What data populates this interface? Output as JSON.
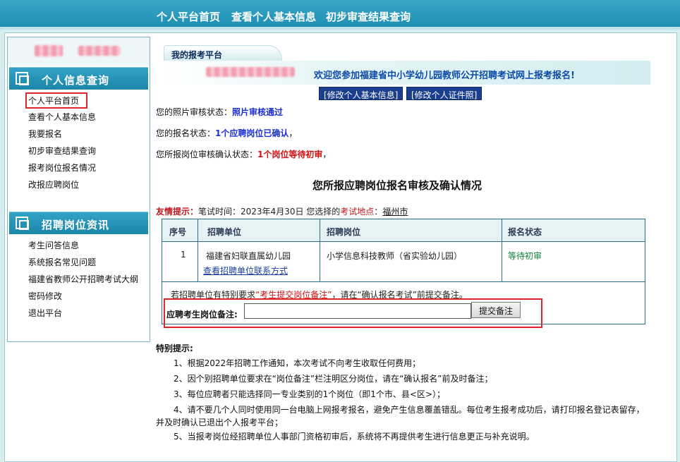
{
  "nav": {
    "items": [
      "个人平台首页",
      "查看个人基本信息",
      "初步审查结果查询"
    ]
  },
  "sidebar": {
    "section1_title": "个人信息查询",
    "section1_items": [
      "个人平台首页",
      "查看个人基本信息",
      "我要报名",
      "初步审查结果查询",
      "报考岗位报名情况",
      "改报应聘岗位"
    ],
    "section2_title": "招聘岗位资讯",
    "section2_items": [
      "考生问答信息",
      "系统报名常见问题",
      "福建省教师公开招聘考试大纲",
      "密码修改",
      "退出平台"
    ]
  },
  "main": {
    "tab_label": "我的报考平台",
    "welcome": "欢迎您参加福建省中小学幼儿园教师公开招聘考试网上报考报名!",
    "edit_basic_button": "[修改个人基本信息]",
    "edit_cert_photo_button": "[修改个人证件照]",
    "photo_status_label": "您的照片审核状态：",
    "photo_status_value": "照片审核通过",
    "reg_status_label": "您的报名状态：",
    "reg_status_value": "1个应聘岗位已确认",
    "reg_status_suffix": "，",
    "post_status_label": "您所报岗位审核确认状态：",
    "post_status_value": "1个岗位等待初审",
    "post_status_suffix": "，",
    "section_title": "您所报应聘岗位报名审核及确认情况",
    "tip_key": "友情提示：",
    "tip_text": "笔试时间：2023年4月30日    您选择的",
    "tip_location_label": "考试地点",
    "tip_colon": "：",
    "tip_city": "福州市"
  },
  "table": {
    "headers": [
      "序号",
      "招聘单位",
      "招聘岗位",
      "报名状态"
    ],
    "row": {
      "index": "1",
      "unit": "福建省妇联直属幼儿园",
      "unit_link": "查看招聘单位联系方式",
      "post": "小学信息科技教师（省实验幼儿园）",
      "status": "等待初审"
    },
    "note_prefix": "若招聘单位有特别要求",
    "note_red": "“考生提交岗位备注”",
    "note_suffix": "，请在“确认报名考试”前提交备注。",
    "remark_label": "应聘考生岗位备注:",
    "remark_value": "",
    "submit_label": "提交备注"
  },
  "special": {
    "title": "特别提示:",
    "items": [
      "1、根据2022年招聘工作通知，本次考试不向考生收取任何费用；",
      "2、因个别招聘单位要求在“岗位备注”栏注明区分岗位，请在“确认报名”前及时备注；",
      "3、每位应聘者只能选择同一专业类别的1个岗位（即1个市、县<区>）；",
      "4、请不要几个人同时使用同一台电脑上网报考报名，避免产生信息覆盖错乱。每位考生报考成功后，请打印报名登记表留存，",
      "5、当报考岗位经招聘单位人事部门资格初审后，系统将不再提供考生进行信息更正与补充说明。"
    ],
    "item4_cont": "并及时确认已退出个人报考平台；"
  }
}
